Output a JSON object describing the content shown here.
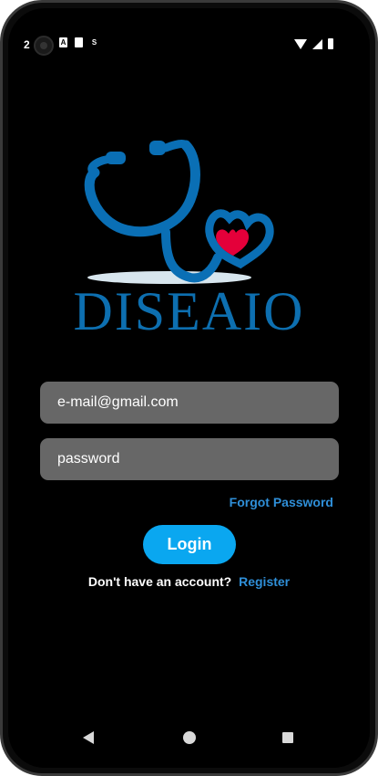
{
  "status_bar": {
    "time": "2",
    "left_icons": [
      "a-icon",
      "sd-card-icon",
      "s-icon"
    ],
    "right_icons": [
      "wifi-icon",
      "signal-icon",
      "battery-icon"
    ]
  },
  "brand": {
    "name": "DISEAIO",
    "color": "#0d6fb0",
    "heart_color": "#e4003a"
  },
  "login_form": {
    "email_placeholder": "e-mail@gmail.com",
    "email_value": "",
    "password_placeholder": "password",
    "password_value": "",
    "forgot_password_label": "Forgot Password",
    "login_label": "Login",
    "no_account_text": "Don't have an account?",
    "register_label": "Register"
  },
  "colors": {
    "background": "#000000",
    "field": "#676767",
    "accent": "#0aa7f0",
    "link": "#2f8fd8"
  },
  "nav_bar": {
    "buttons": [
      "back-icon",
      "home-icon",
      "recents-icon"
    ]
  }
}
